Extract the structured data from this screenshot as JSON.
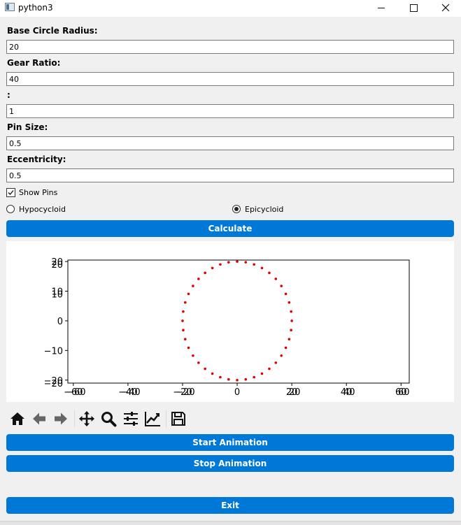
{
  "window": {
    "title": "python3",
    "icon": "python-window-icon"
  },
  "form": {
    "base_radius_label": "Base Circle Radius:",
    "base_radius_value": "20",
    "gear_ratio_label": "Gear Ratio:",
    "gear_ratio_value": "40",
    "ratio_sep_label": ":",
    "ratio_sep_value": "1",
    "pin_size_label": "Pin Size:",
    "pin_size_value": "0.5",
    "eccentricity_label": "Eccentricity:",
    "eccentricity_value": "0.5",
    "show_pins_label": "Show Pins",
    "show_pins_checked": true,
    "hypocycloid_label": "Hypocycloid",
    "epicycloid_label": "Epicycloid",
    "selected_mode": "Epicycloid"
  },
  "buttons": {
    "calculate": "Calculate",
    "start_animation": "Start Animation",
    "stop_animation": "Stop Animation",
    "exit": "Exit"
  },
  "toolbar": {
    "items": [
      "home-icon",
      "back-icon",
      "forward-icon",
      "pan-icon",
      "zoom-icon",
      "configure-subplots-icon",
      "edit-axis-icon",
      "save-icon"
    ]
  },
  "chart_data": {
    "type": "scatter",
    "title": "",
    "xlabel": "",
    "ylabel": "",
    "xlim": [
      -62,
      63
    ],
    "ylim": [
      -21,
      20.5
    ],
    "xticks": [
      -60,
      -40,
      -20,
      0,
      20,
      40,
      60
    ],
    "xtick_labels": [
      "−60",
      "−40",
      "−20",
      "0",
      "20",
      "40",
      "60"
    ],
    "yticks": [
      -20,
      -10,
      0,
      10,
      20
    ],
    "ytick_labels": [
      "−20",
      "−10",
      "0",
      "10",
      "20"
    ],
    "overlapping_tick_labels": {
      "x": [
        "−60",
        "−40",
        "−20",
        "20",
        "40",
        "60"
      ],
      "y": [
        "−20",
        "20",
        "10"
      ]
    },
    "grid": false,
    "point_color": "#e00000",
    "circle_points": {
      "center": [
        0,
        0
      ],
      "radius": 20,
      "count": 40
    }
  }
}
